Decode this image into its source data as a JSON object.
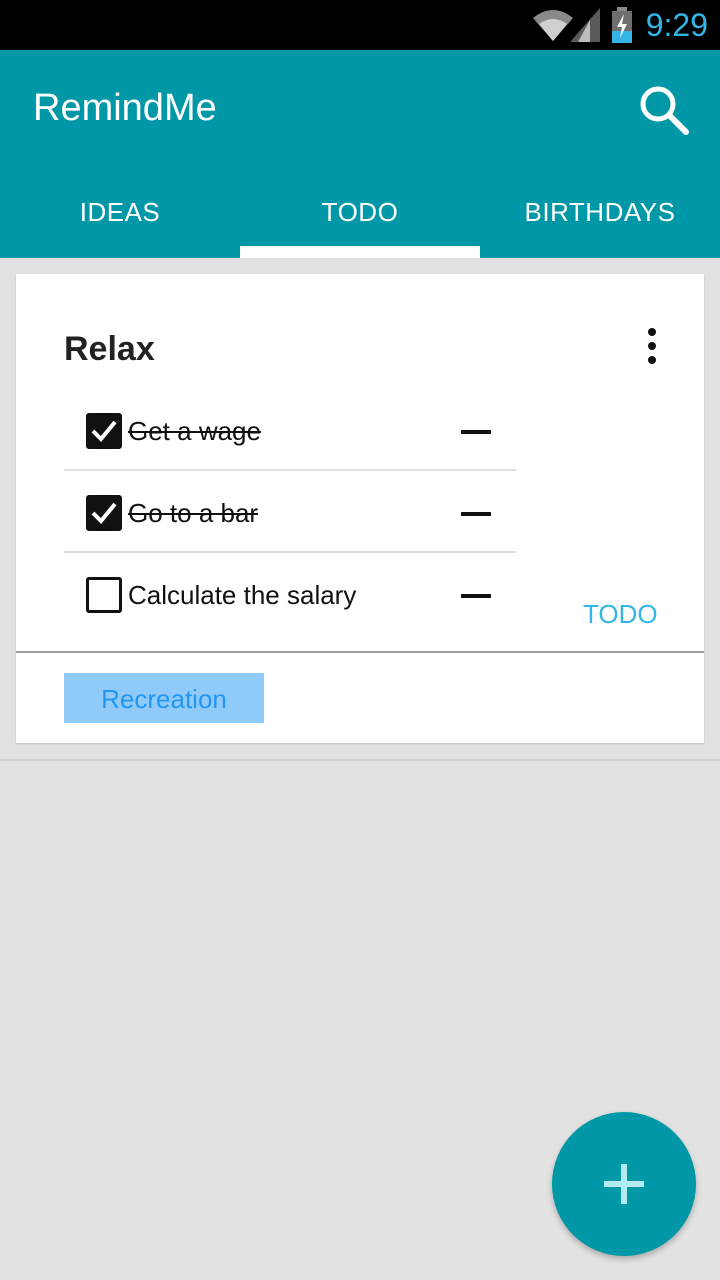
{
  "status_bar": {
    "time": "9:29",
    "icons": [
      "wifi-icon",
      "signal-icon",
      "battery-charging-icon"
    ],
    "time_color": "#33b5e5"
  },
  "app_bar": {
    "title": "RemindMe",
    "search_icon": "search-icon",
    "color": "#0097a7"
  },
  "tabs": [
    {
      "label": "IDEAS",
      "selected": false
    },
    {
      "label": "TODO",
      "selected": true
    },
    {
      "label": "BIRTHDAYS",
      "selected": false
    }
  ],
  "card": {
    "title": "Relax",
    "menu_icon": "more-vert-icon",
    "items": [
      {
        "text": "Get a wage",
        "checked": true
      },
      {
        "text": "Go to a bar",
        "checked": true
      },
      {
        "text": "Calculate the salary",
        "checked": false
      }
    ],
    "category": "TODO",
    "tag": "Recreation",
    "accent_color": "#33b5e5"
  },
  "fab": {
    "icon": "plus-icon",
    "color": "#0097a7"
  }
}
